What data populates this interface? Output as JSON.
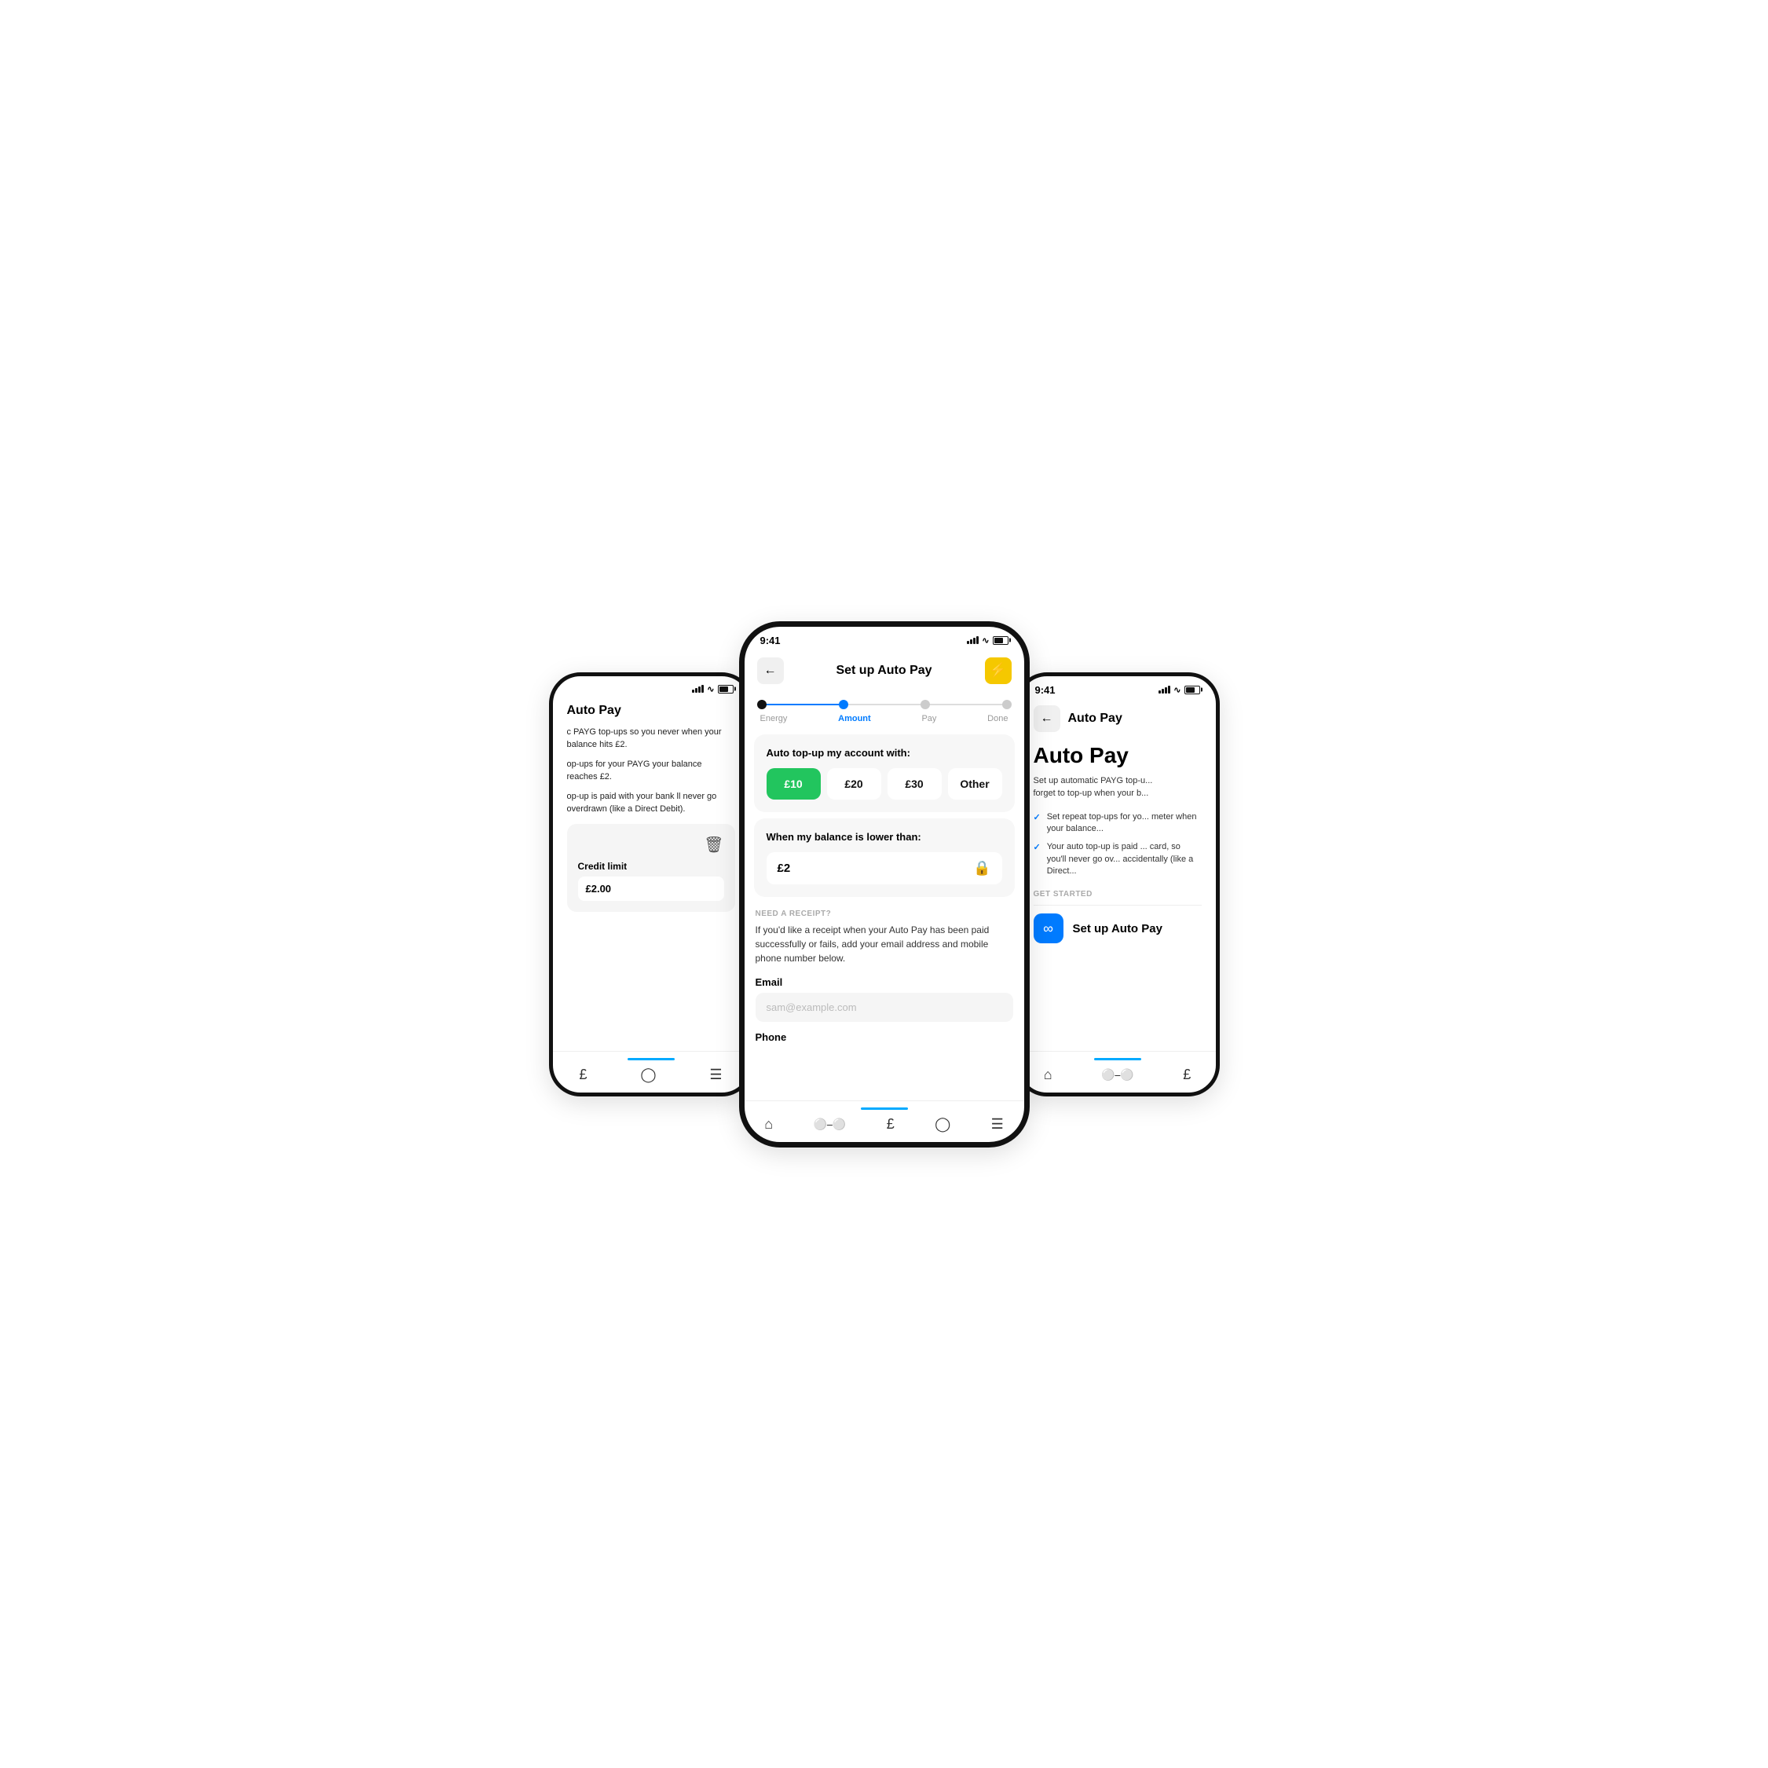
{
  "left_phone": {
    "header": "Auto Pay",
    "body1": "c PAYG top-ups so you never when your balance hits £2.",
    "body2": "op-ups for your PAYG your balance reaches £2.",
    "body3": "op-up is paid with your bank ll never go overdrawn (like a Direct Debit).",
    "card_icon": "🗑",
    "card_title": "Credit limit",
    "card_value": "£2.00",
    "nav_icons": [
      "£",
      "?",
      "≡"
    ]
  },
  "center_phone": {
    "time": "9:41",
    "title": "Set up Auto Pay",
    "back_label": "←",
    "lightning": "⚡",
    "steps": [
      {
        "label": "Energy",
        "state": "done"
      },
      {
        "label": "Amount",
        "state": "active"
      },
      {
        "label": "Pay",
        "state": "inactive"
      },
      {
        "label": "Done",
        "state": "inactive"
      }
    ],
    "topup_title": "Auto top-up my account with:",
    "amounts": [
      {
        "label": "£10",
        "selected": true
      },
      {
        "label": "£20",
        "selected": false
      },
      {
        "label": "£30",
        "selected": false
      },
      {
        "label": "Other",
        "selected": false
      }
    ],
    "balance_title": "When my balance is lower than:",
    "balance_value": "£2",
    "receipt_label": "NEED A RECEIPT?",
    "receipt_desc": "If you'd like a receipt when your Auto Pay has been paid successfully or fails, add your email address and mobile phone number below.",
    "email_label": "Email",
    "email_placeholder": "sam@example.com",
    "phone_label": "Phone",
    "nav_icons": [
      "⌂",
      "⋯",
      "£",
      "?",
      "≡"
    ]
  },
  "right_phone": {
    "time": "9:41",
    "back_label": "←",
    "page_title": "Auto Pay",
    "autopay_heading": "Auto Pay",
    "autopay_desc": "Set up automatic PAYG top-u... forget to top-up when your b...",
    "check_items": [
      "Set repeat top-ups for yo... meter when your balance...",
      "Your auto top-up is paid ... card, so you'll never go ov... accidentally (like a Direct..."
    ],
    "get_started_label": "GET STARTED",
    "setup_btn_label": "Set up Auto Pay",
    "setup_icon": "∞",
    "nav_icons": [
      "⌂",
      "⋯",
      "£"
    ]
  }
}
